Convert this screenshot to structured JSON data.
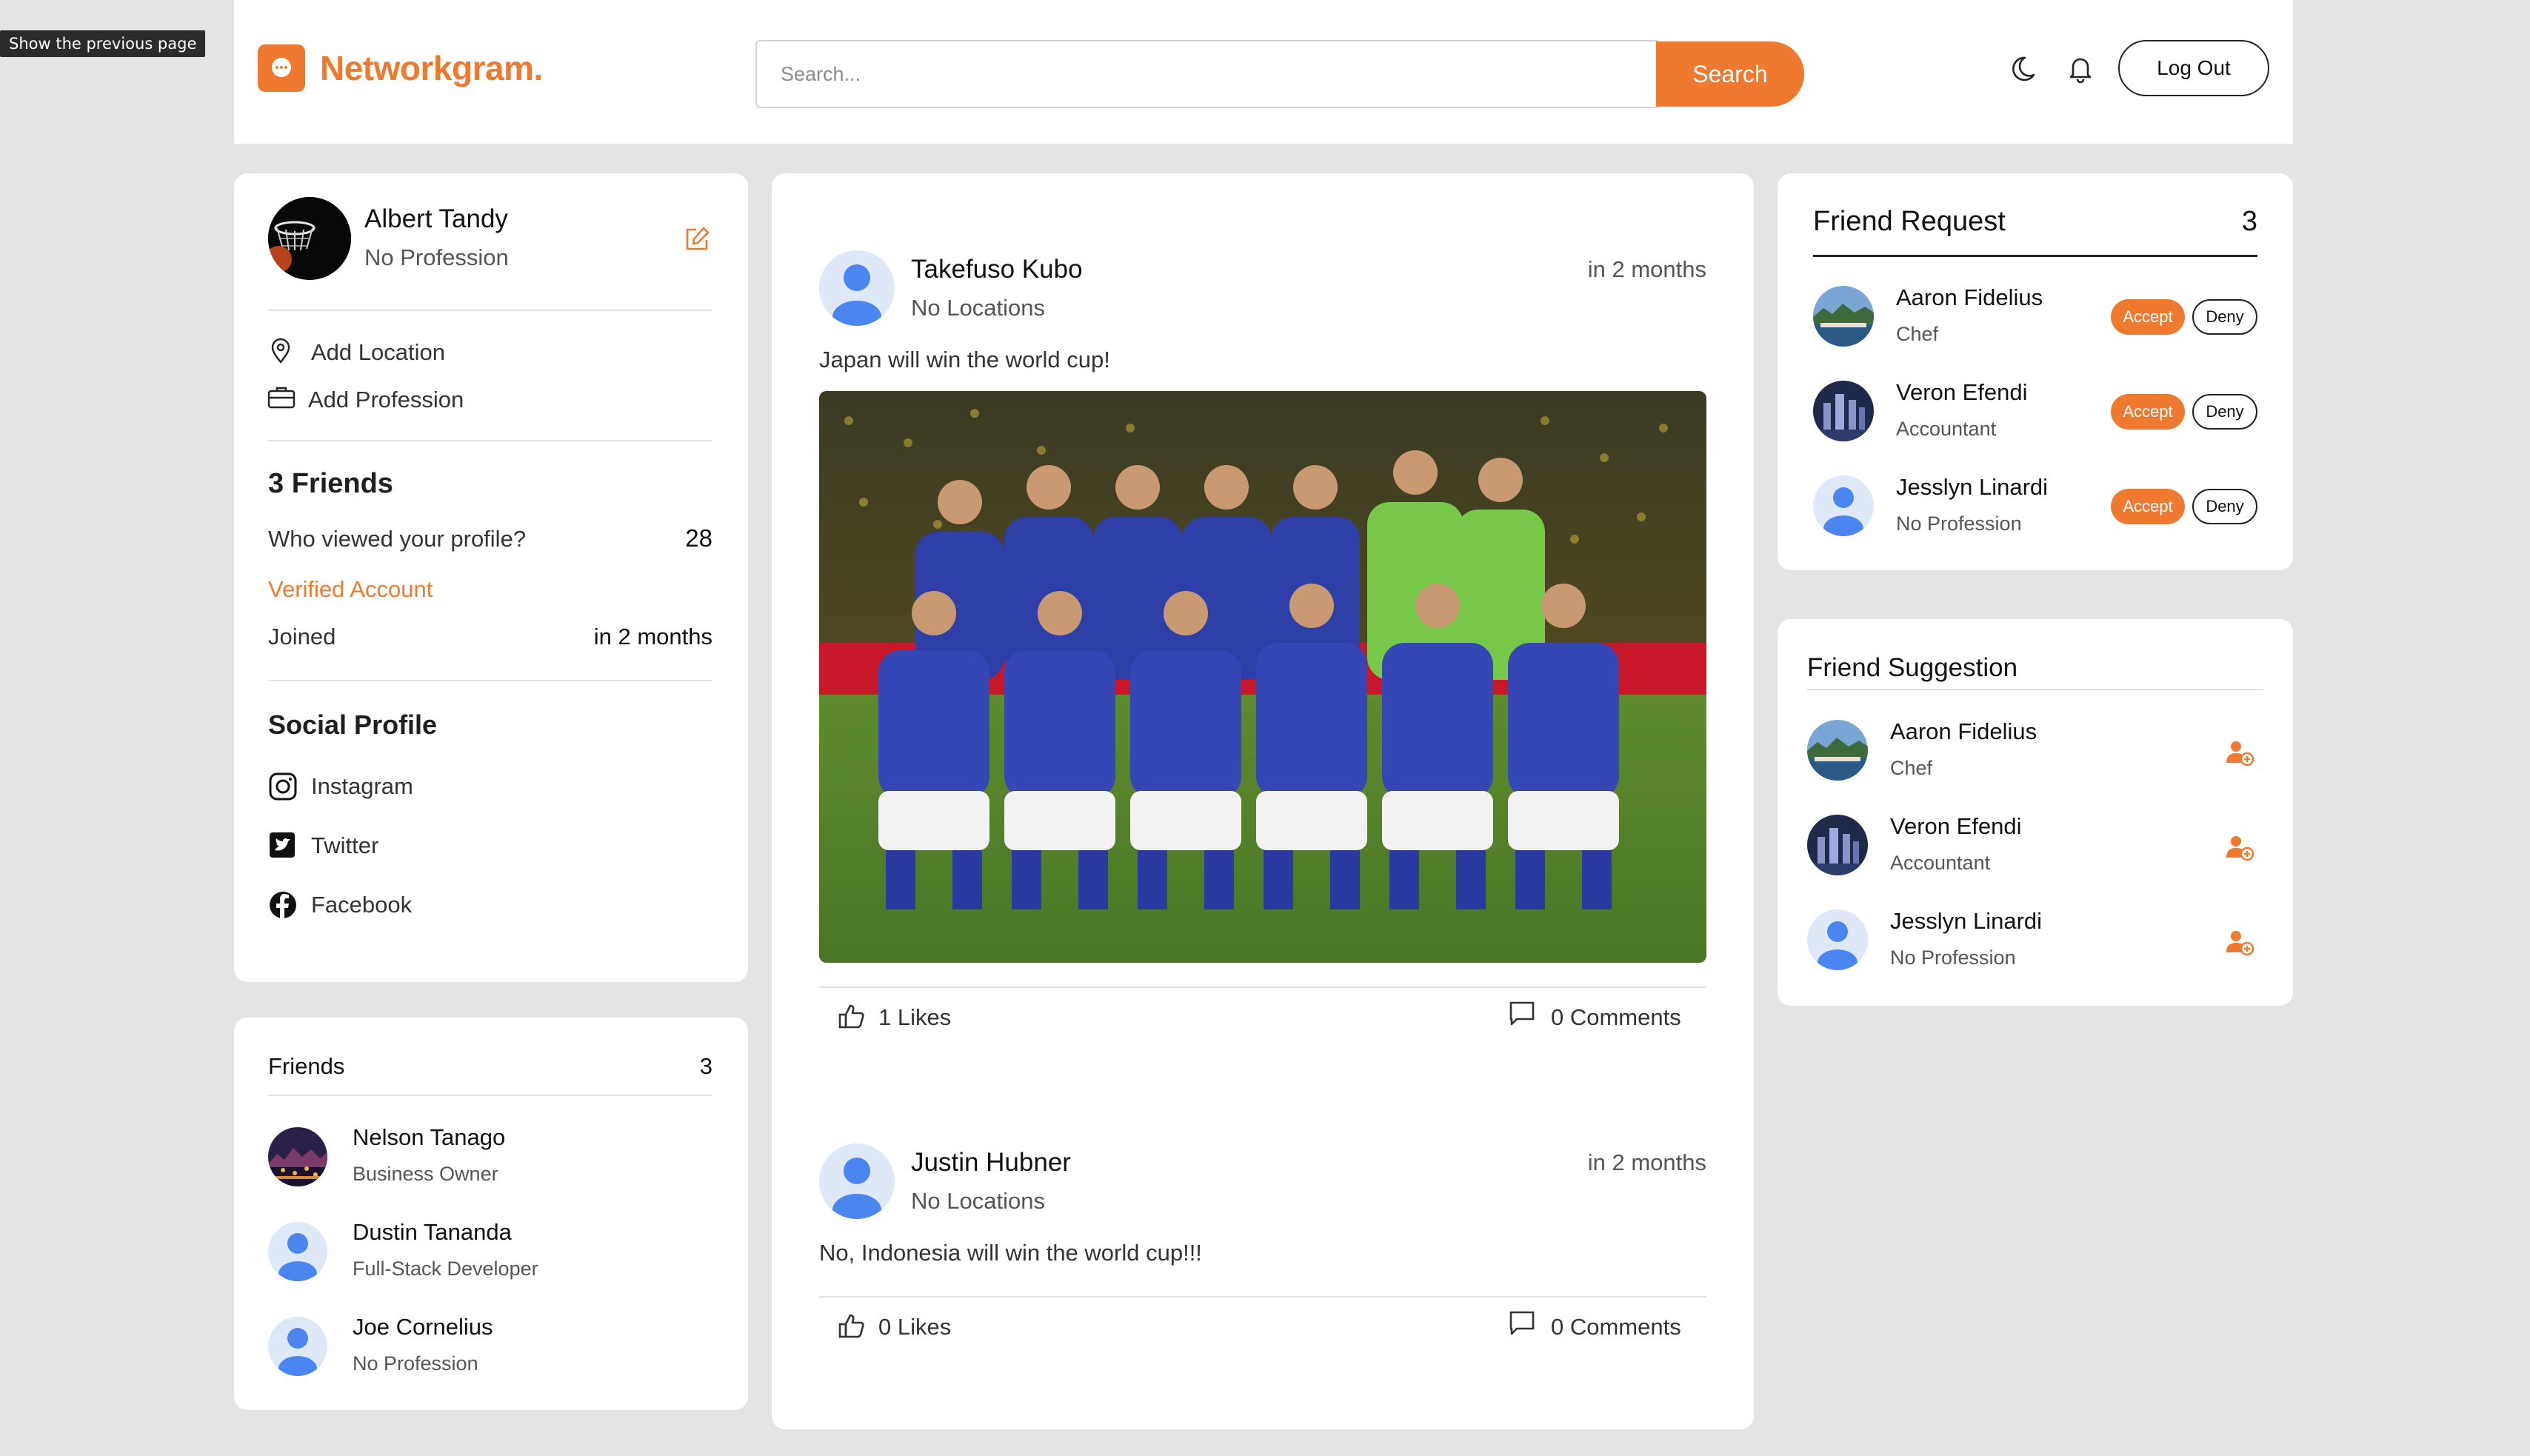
{
  "tooltip": "Show the previous page",
  "header": {
    "logo_text": "Networkgram.",
    "search_placeholder": "Search...",
    "search_button": "Search",
    "logout_button": "Log Out",
    "icons": [
      "moon-icon",
      "bell-icon"
    ]
  },
  "profile": {
    "name": "Albert Tandy",
    "profession": "No Profession",
    "add_location": "Add Location",
    "add_profession": "Add Profession",
    "friends_count_label": "3 Friends",
    "viewed_label": "Who viewed your profile?",
    "viewed_count": "28",
    "verified": "Verified Account",
    "joined_label": "Joined",
    "joined_value": "in 2 months",
    "social_title": "Social Profile",
    "social": [
      "Instagram",
      "Twitter",
      "Facebook"
    ]
  },
  "friends": {
    "title": "Friends",
    "count": "3",
    "items": [
      {
        "name": "Nelson Tanago",
        "role": "Business Owner"
      },
      {
        "name": "Dustin Tananda",
        "role": "Full-Stack Developer"
      },
      {
        "name": "Joe Cornelius",
        "role": "No Profession"
      }
    ]
  },
  "posts": [
    {
      "author": "Takefuso Kubo",
      "location": "No Locations",
      "time": "in 2 months",
      "text": "Japan will win the world cup!",
      "likes": "1 Likes",
      "comments": "0 Comments"
    },
    {
      "author": "Justin Hubner",
      "location": "No Locations",
      "time": "in 2 months",
      "text": "No, Indonesia will win the world cup!!!",
      "likes": "0 Likes",
      "comments": "0 Comments"
    }
  ],
  "friend_requests": {
    "title": "Friend Request",
    "count": "3",
    "accept": "Accept",
    "deny": "Deny",
    "items": [
      {
        "name": "Aaron Fidelius",
        "role": "Chef"
      },
      {
        "name": "Veron Efendi",
        "role": "Accountant"
      },
      {
        "name": "Jesslyn Linardi",
        "role": "No Profession"
      }
    ]
  },
  "suggestions": {
    "title": "Friend Suggestion",
    "items": [
      {
        "name": "Aaron Fidelius",
        "role": "Chef"
      },
      {
        "name": "Veron Efendi",
        "role": "Accountant"
      },
      {
        "name": "Jesslyn Linardi",
        "role": "No Profession"
      }
    ]
  },
  "colors": {
    "accent": "#ef7a2f",
    "background": "#e4e4e4",
    "card": "#ffffff"
  }
}
